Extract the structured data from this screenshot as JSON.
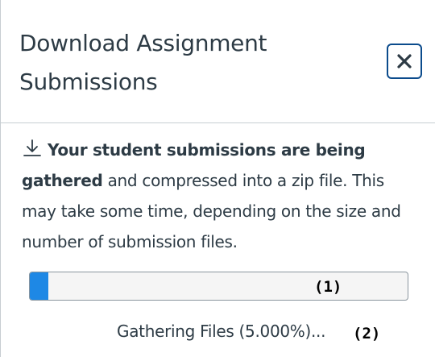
{
  "dialog": {
    "title_line1": "Download Assignment",
    "title_line2": "Submissions",
    "close_label": "Close",
    "close_glyph": "×"
  },
  "message": {
    "icon": "download-icon",
    "bold_text": "Your student submissions are being gathered",
    "rest_text": " and compressed into a zip file. This may take some time, depending on the size and number of submission files."
  },
  "progress": {
    "percent": 5.0,
    "status_text": "Gathering Files (5.000%)...",
    "fill_color": "#1e88e5"
  },
  "annotations": {
    "marker_1": "(1)",
    "marker_2": "(2)"
  },
  "colors": {
    "text": "#2d3b45",
    "close_border": "#0b4b8c",
    "divider": "#c7cdd1"
  }
}
